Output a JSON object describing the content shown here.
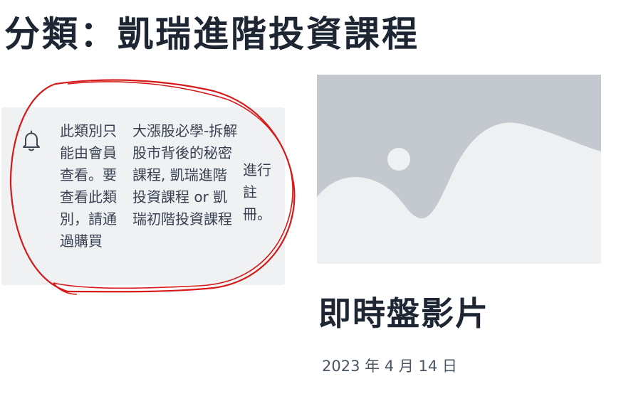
{
  "header": {
    "title": "分類：凱瑞進階投資課程"
  },
  "notice": {
    "icon": "bell-icon",
    "col1": "此類別只能由會員查看。要查看此類別，請通過購買",
    "col2": "大漲股必學-拆解股市背後的秘密課程, 凱瑞進階投資課程 or 凱瑞初階投資課程",
    "col3": "進行註冊。"
  },
  "post": {
    "thumbnail_icon": "image-placeholder-icon",
    "title": "即時盤影片",
    "date": "2023 年 4 月 14 日"
  },
  "colors": {
    "annotation": "#d61a1a",
    "notice_bg": "#f0f1f3",
    "placeholder_bg": "#c4c9cf",
    "placeholder_fg": "#eef0f2"
  }
}
